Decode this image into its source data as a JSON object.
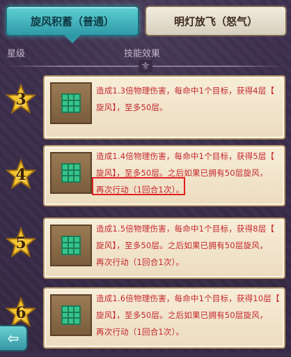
{
  "tabs": [
    {
      "label": "旋风积蓄（普通）",
      "active": true
    },
    {
      "label": "明灯放飞（怒气）",
      "active": false
    }
  ],
  "headers": {
    "star": "星级",
    "effect": "技能效果"
  },
  "rows": [
    {
      "level": "3",
      "lines": [
        "造成1.3倍物理伤害，每命中1个目标，获得4层【",
        "旋风】，至多50层。"
      ]
    },
    {
      "level": "4",
      "lines": [
        "造成1.4倍物理伤害，每命中1个目标，获得5层【",
        "旋风】，至多50层。之后如果已拥有50层旋风，",
        "再次行动（1回合1次）。"
      ]
    },
    {
      "level": "5",
      "lines": [
        "造成1.5倍物理伤害，每命中1个目标，获得8层【",
        "旋风】，至多50层。之后如果已拥有50层旋风，",
        "再次行动（1回合1次）。"
      ]
    },
    {
      "level": "6",
      "lines": [
        "造成1.6倍物理伤害，每命中1个目标，获得10层【",
        "旋风】，至多50层。之后如果已拥有50层旋风，",
        "再次行动（1回合1次）。"
      ]
    }
  ],
  "colors": {
    "accent": "#3fb5bf",
    "text_red": "#c4262b",
    "highlight": "#e2201f"
  },
  "icons": {
    "back": "back-arrow-icon",
    "skill": "skill-grid-icon",
    "star": "star-icon"
  }
}
